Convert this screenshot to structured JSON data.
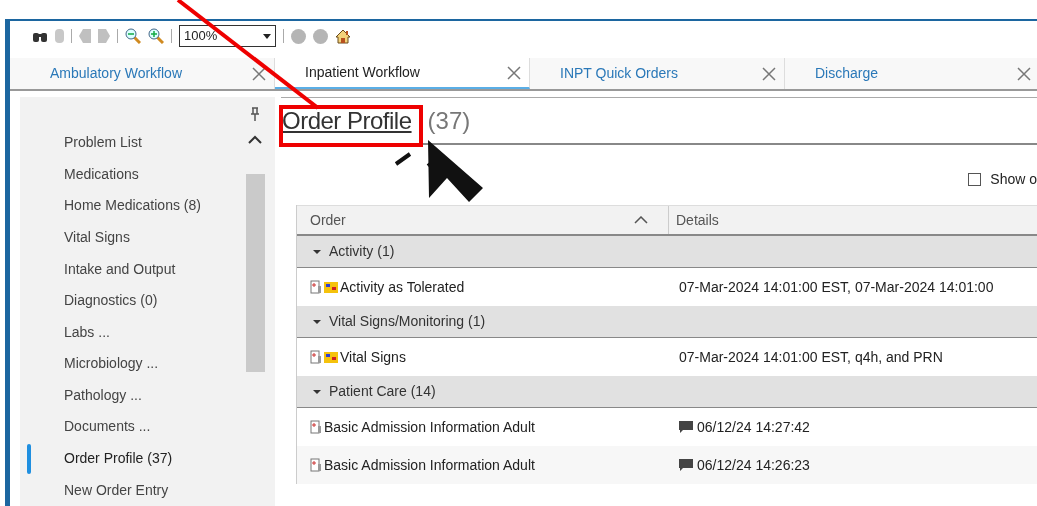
{
  "toolbar": {
    "zoom": {
      "value": "100%"
    }
  },
  "tabs": [
    {
      "label": "Ambulatory Workflow",
      "selected": false
    },
    {
      "label": "Inpatient Workflow",
      "selected": true
    },
    {
      "label": "INPT Quick Orders",
      "selected": false
    },
    {
      "label": "Discharge",
      "selected": false
    }
  ],
  "sidebar": {
    "items": [
      {
        "label": "Problem List",
        "selected": false
      },
      {
        "label": "Medications",
        "selected": false
      },
      {
        "label": "Home Medications (8)",
        "selected": false
      },
      {
        "label": "Vital Signs",
        "selected": false
      },
      {
        "label": "Intake and Output",
        "selected": false
      },
      {
        "label": "Diagnostics (0)",
        "selected": false
      },
      {
        "label": "Labs ...",
        "selected": false
      },
      {
        "label": "Microbiology ...",
        "selected": false
      },
      {
        "label": "Pathology ...",
        "selected": false
      },
      {
        "label": "Documents ...",
        "selected": false
      },
      {
        "label": "Order Profile (37)",
        "selected": true
      },
      {
        "label": "New Order Entry",
        "selected": false
      }
    ]
  },
  "page": {
    "title": "Order Profile",
    "count": "(37)",
    "show_option": {
      "label": "Show o",
      "checked": false
    }
  },
  "table": {
    "columns": [
      "Order",
      "Details"
    ],
    "rows": [
      {
        "kind": "group",
        "label": "Activity (1)",
        "expanded": true
      },
      {
        "kind": "order",
        "order": "Activity as Tolerated",
        "details": "07-Mar-2024 14:01:00 EST, 07-Mar-2024 14:01:00",
        "flag_icon": true,
        "comment_icon": false
      },
      {
        "kind": "group",
        "label": "Vital Signs/Monitoring (1)",
        "expanded": true
      },
      {
        "kind": "order",
        "order": "Vital Signs",
        "details": "07-Mar-2024 14:01:00 EST, q4h, and PRN",
        "flag_icon": true,
        "comment_icon": false
      },
      {
        "kind": "group",
        "label": "Patient Care (14)",
        "expanded": true
      },
      {
        "kind": "order",
        "order": "Basic Admission Information Adult",
        "details": "06/12/24 14:27:42",
        "flag_icon": false,
        "comment_icon": true
      },
      {
        "kind": "order",
        "order": "Basic Admission Information Adult",
        "details": "06/12/24 14:26:23",
        "flag_icon": false,
        "comment_icon": true
      }
    ]
  }
}
